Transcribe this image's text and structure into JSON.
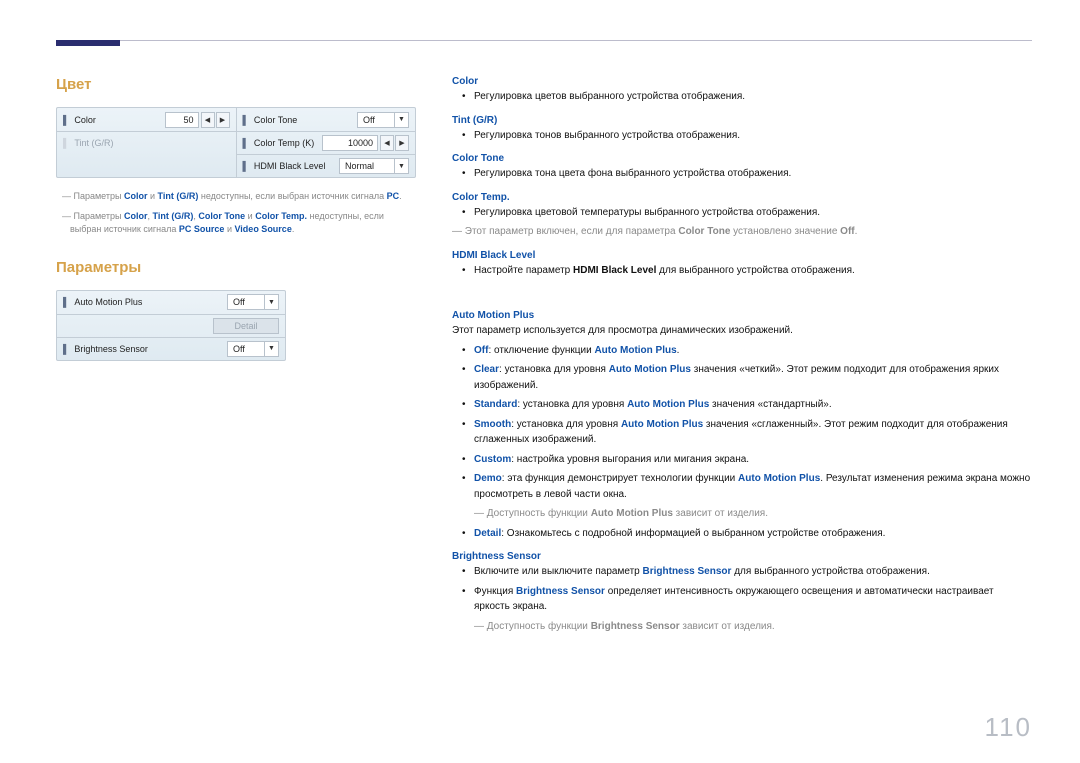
{
  "page_number": "110",
  "left": {
    "section_color_title": "Цвет",
    "panel_color": {
      "row1_left_label": "Color",
      "row1_left_value": "50",
      "row2_left_label": "Tint (G/R)",
      "row1_right_label": "Color Tone",
      "row1_right_value": "Off",
      "row2_right_label": "Color Temp (K)",
      "row2_right_value": "10000",
      "row3_right_label": "HDMI Black Level",
      "row3_right_value": "Normal"
    },
    "note1_prefix": "― Параметры ",
    "note1_b1": "Color",
    "note1_mid1": " и ",
    "note1_b2": "Tint (G/R)",
    "note1_mid2": " недоступны, если выбран источник сигнала ",
    "note1_b3": "PC",
    "note1_end": ".",
    "note2_prefix": "― Параметры ",
    "note2_b1": "Color",
    "note2_c1": ", ",
    "note2_b2": "Tint (G/R)",
    "note2_c2": ", ",
    "note2_b3": "Color Tone",
    "note2_c3": " и ",
    "note2_b4": "Color Temp.",
    "note2_mid": " недоступны, если выбран источник сигнала ",
    "note2_b5": "PC Source",
    "note2_c4": " и ",
    "note2_b6": "Video Source",
    "note2_end": ".",
    "section_params_title": "Параметры",
    "panel_params": {
      "row1_label": "Auto Motion Plus",
      "row1_value": "Off",
      "row2_button": "Detail",
      "row3_label": "Brightness Sensor",
      "row3_value": "Off"
    }
  },
  "right": {
    "color": {
      "title": "Color",
      "b1": "Регулировка цветов выбранного устройства отображения."
    },
    "tint": {
      "title": "Tint (G/R)",
      "b1": "Регулировка тонов выбранного устройства отображения."
    },
    "ctone": {
      "title": "Color Tone",
      "b1": "Регулировка тона цвета фона выбранного устройства отображения."
    },
    "ctemp": {
      "title": "Color Temp.",
      "b1": "Регулировка цветовой температуры выбранного устройства отображения.",
      "note_prefix": "― Этот параметр включен, если для параметра ",
      "note_b1": "Color Tone",
      "note_mid": " установлено значение ",
      "note_b2": "Off",
      "note_end": "."
    },
    "hdmi": {
      "title": "HDMI Black Level",
      "b1_pre": "Настройте параметр ",
      "b1_bold": "HDMI Black Level",
      "b1_post": " для выбранного устройства отображения."
    },
    "amp": {
      "title": "Auto Motion Plus",
      "intro": "Этот параметр используется для просмотра динамических изображений.",
      "li_off_b": "Off",
      "li_off_t1": ": отключение функции ",
      "li_off_b2": "Auto Motion Plus",
      "li_off_t2": ".",
      "li_clear_b": "Clear",
      "li_clear_t1": ": установка для уровня ",
      "li_clear_b2": "Auto Motion Plus",
      "li_clear_t2": " значения «четкий». Этот режим подходит для отображения ярких изображений.",
      "li_std_b": "Standard",
      "li_std_t1": ": установка для уровня ",
      "li_std_b2": "Auto Motion Plus",
      "li_std_t2": " значения «стандартный».",
      "li_smooth_b": "Smooth",
      "li_smooth_t1": ": установка для уровня ",
      "li_smooth_b2": "Auto Motion Plus",
      "li_smooth_t2": " значения «сглаженный». Этот режим подходит для отображения сглаженных изображений.",
      "li_custom_b": "Custom",
      "li_custom_t": ": настройка уровня выгорания или мигания экрана.",
      "li_demo_b": "Demo",
      "li_demo_t1": ": эта функция демонстрирует технологии функции ",
      "li_demo_b2": "Auto Motion Plus",
      "li_demo_t2": ". Результат изменения режима экрана можно просмотреть в левой части окна.",
      "note_prefix": "― Доступность функции ",
      "note_b": "Auto Motion Plus",
      "note_suffix": " зависит от изделия.",
      "li_detail_b": "Detail",
      "li_detail_t": ": Ознакомьтесь с подробной информацией о выбранном устройстве отображения."
    },
    "bs": {
      "title": "Brightness Sensor",
      "b1_pre": "Включите или выключите параметр ",
      "b1_b": "Brightness Sensor",
      "b1_post": " для выбранного устройства отображения.",
      "b2_pre": "Функция ",
      "b2_b": "Brightness Sensor",
      "b2_post": " определяет интенсивность окружающего освещения и автоматически настраивает яркость экрана.",
      "note_prefix": "― Доступность функции ",
      "note_b": "Brightness Sensor",
      "note_suffix": " зависит от изделия."
    }
  }
}
